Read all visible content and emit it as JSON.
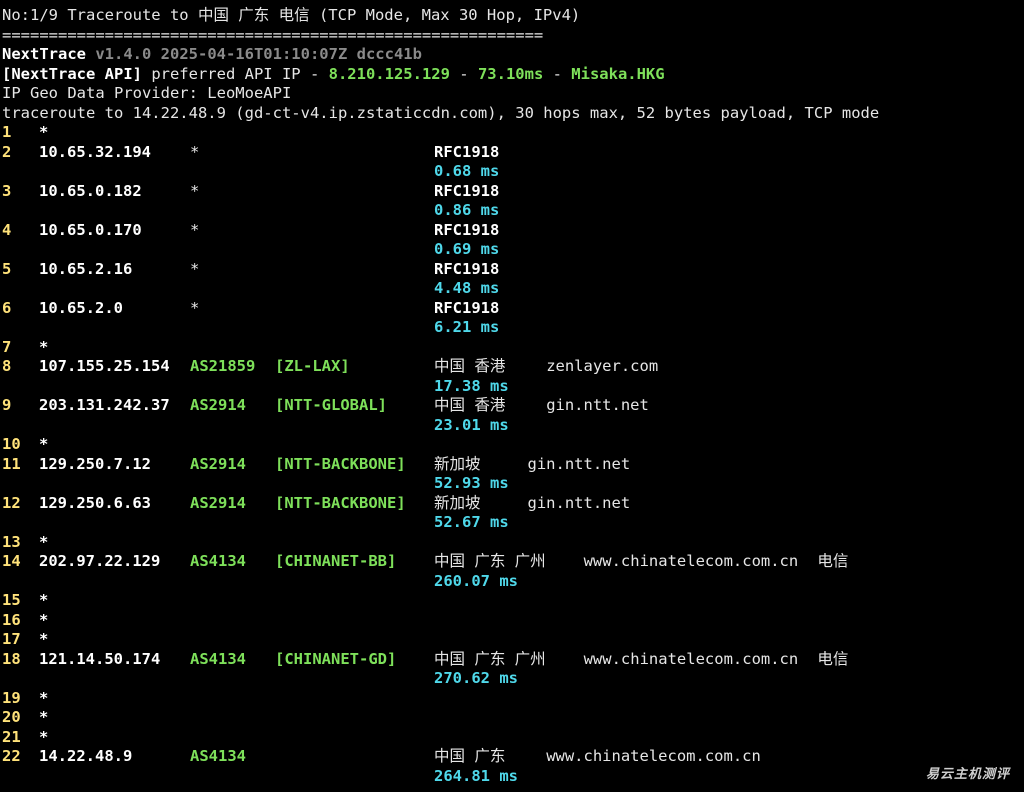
{
  "header": {
    "line1": "No:1/9 Traceroute to 中国 广东 电信 (TCP Mode, Max 30 Hop, IPv4)",
    "separator": "==========================================================",
    "app_name": "NextTrace",
    "version_info": " v1.4.0 2025-04-16T01:10:07Z dccc41b",
    "api_label": "[NextTrace API]",
    "api_text": " preferred API IP - ",
    "api_ip": "8.210.125.129",
    "api_dash1": " - ",
    "api_latency": "73.10ms",
    "api_dash2": " - ",
    "api_node": "Misaka.HKG",
    "geo_provider": "IP Geo Data Provider: LeoMoeAPI",
    "trace_line": "traceroute to 14.22.48.9 (gd-ct-v4.ip.zstaticcdn.com), 30 hops max, 52 bytes payload, TCP mode"
  },
  "hops": [
    {
      "num": "1",
      "star": "*"
    },
    {
      "num": "2",
      "ip": "10.65.32.194",
      "asn": "*",
      "tag": "",
      "geo": "RFC1918",
      "latency": "0.68 ms"
    },
    {
      "num": "3",
      "ip": "10.65.0.182",
      "asn": "*",
      "tag": "",
      "geo": "RFC1918",
      "latency": "0.86 ms"
    },
    {
      "num": "4",
      "ip": "10.65.0.170",
      "asn": "*",
      "tag": "",
      "geo": "RFC1918",
      "latency": "0.69 ms"
    },
    {
      "num": "5",
      "ip": "10.65.2.16",
      "asn": "*",
      "tag": "",
      "geo": "RFC1918",
      "latency": "4.48 ms"
    },
    {
      "num": "6",
      "ip": "10.65.2.0",
      "asn": "*",
      "tag": "",
      "geo": "RFC1918",
      "latency": "6.21 ms"
    },
    {
      "num": "7",
      "star": "*"
    },
    {
      "num": "8",
      "ip": "107.155.25.154",
      "asn": "AS21859",
      "tag": "[ZL-LAX]",
      "geo": "中国 香港",
      "domain": "zenlayer.com",
      "latency": "17.38 ms"
    },
    {
      "num": "9",
      "ip": "203.131.242.37",
      "asn": "AS2914",
      "tag": "[NTT-GLOBAL]",
      "geo": "中国 香港",
      "domain": "gin.ntt.net",
      "latency": "23.01 ms"
    },
    {
      "num": "10",
      "star": "*"
    },
    {
      "num": "11",
      "ip": "129.250.7.12",
      "asn": "AS2914",
      "tag": "[NTT-BACKBONE]",
      "geo": "新加坡",
      "domain": "gin.ntt.net",
      "latency": "52.93 ms"
    },
    {
      "num": "12",
      "ip": "129.250.6.63",
      "asn": "AS2914",
      "tag": "[NTT-BACKBONE]",
      "geo": "新加坡",
      "domain": "gin.ntt.net",
      "latency": "52.67 ms"
    },
    {
      "num": "13",
      "star": "*"
    },
    {
      "num": "14",
      "ip": "202.97.22.129",
      "asn": "AS4134",
      "tag": "[CHINANET-BB]",
      "geo": "中国 广东 广州",
      "domain": "www.chinatelecom.com.cn",
      "isp": "电信",
      "latency": "260.07 ms"
    },
    {
      "num": "15",
      "star": "*"
    },
    {
      "num": "16",
      "star": "*"
    },
    {
      "num": "17",
      "star": "*"
    },
    {
      "num": "18",
      "ip": "121.14.50.174",
      "asn": "AS4134",
      "tag": "[CHINANET-GD]",
      "geo": "中国 广东 广州",
      "domain": "www.chinatelecom.com.cn",
      "isp": "电信",
      "latency": "270.62 ms"
    },
    {
      "num": "19",
      "star": "*"
    },
    {
      "num": "20",
      "star": "*"
    },
    {
      "num": "21",
      "star": "*"
    },
    {
      "num": "22",
      "ip": "14.22.48.9",
      "asn": "AS4134",
      "tag": "",
      "geo": "中国 广东",
      "domain": "www.chinatelecom.com.cn",
      "latency": "264.81 ms"
    }
  ],
  "watermark": "易云主机测评"
}
